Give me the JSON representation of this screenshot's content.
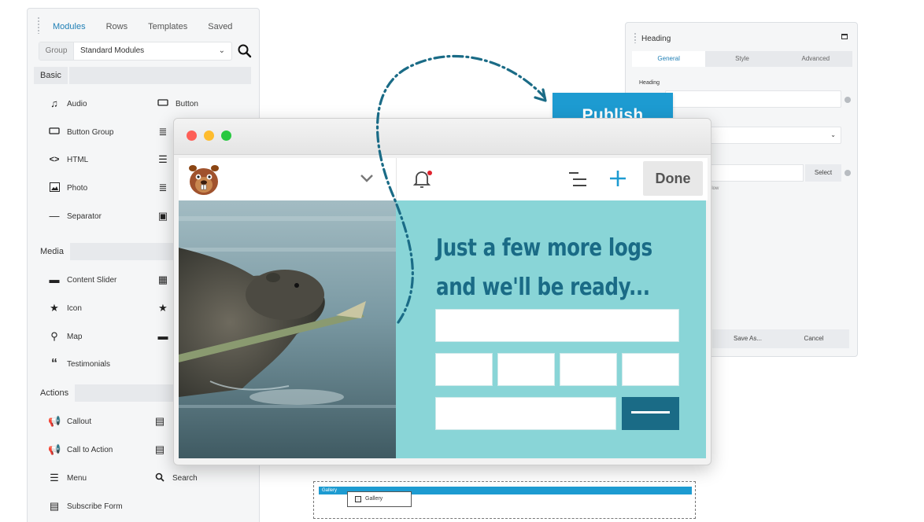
{
  "modules_panel": {
    "tabs": [
      "Modules",
      "Rows",
      "Templates",
      "Saved"
    ],
    "group_label": "Group",
    "group_select": "Standard Modules",
    "sections": {
      "basic": "Basic",
      "media": "Media",
      "actions": "Actions"
    },
    "basic_left": [
      "Audio",
      "Button Group",
      "HTML",
      "Photo",
      "Separator"
    ],
    "basic_right": [
      "Button"
    ],
    "media_left": [
      "Content Slider",
      "Icon",
      "Map",
      "Testimonials"
    ],
    "actions_left": [
      "Callout",
      "Call to Action",
      "Menu",
      "Subscribe Form"
    ],
    "actions_right": [
      "Search"
    ]
  },
  "settings_panel": {
    "title": "Heading",
    "tabs": [
      "General",
      "Style",
      "Advanced"
    ],
    "field_label": "Heading",
    "select_button": "Select",
    "hint": "llow",
    "save_as": "Save As...",
    "cancel": "Cancel"
  },
  "browser": {
    "done": "Done",
    "headline_line1": "Just a few more logs",
    "headline_line2": "and we'll be ready..."
  },
  "publish": "Publish",
  "gallery": {
    "bar_label": "Gallery",
    "chip_label": "Gallery"
  },
  "colors": {
    "accent": "#1d9bd1",
    "teal_bg": "#89d5d7",
    "dark_teal": "#1a6b86"
  }
}
